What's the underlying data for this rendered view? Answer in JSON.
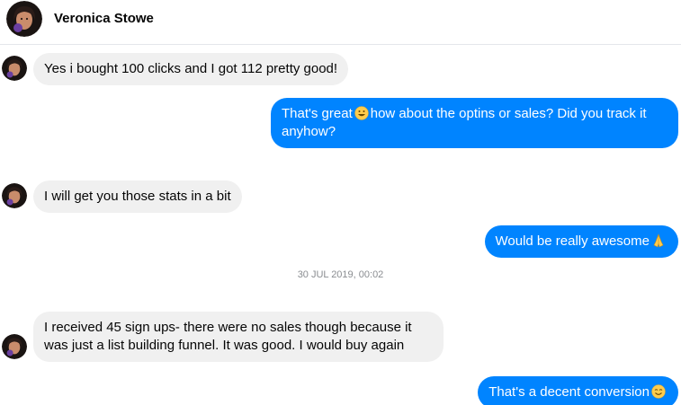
{
  "contact": {
    "name": "Veronica Stowe"
  },
  "colors": {
    "outgoing": "#0084ff",
    "incoming": "#f0f0f0",
    "divider": "#e4e6eb"
  },
  "messages": [
    {
      "direction": "incoming",
      "text": "Yes i bought 100 clicks and  I got 112 pretty good!"
    },
    {
      "direction": "outgoing",
      "text_before": "That's great",
      "emoji": "grinning-face-emoji",
      "text_after": "how about the optins or sales? Did you track it anyhow?"
    },
    {
      "direction": "incoming",
      "text": "I will get you those stats in a bit"
    },
    {
      "direction": "outgoing",
      "text": "Would be really awesome",
      "emoji": "folded-hands-emoji"
    },
    {
      "direction": "incoming",
      "text": "I received 45 sign ups- there were no sales though because it was just a list building funnel. It was good. I would buy again"
    },
    {
      "direction": "outgoing",
      "text": "That's a decent conversion",
      "emoji": "smiling-face-emoji"
    }
  ],
  "timestamp": "30 JUL 2019, 00:02"
}
